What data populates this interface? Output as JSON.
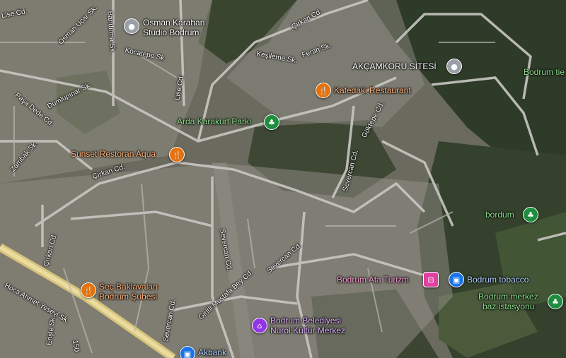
{
  "colors": {
    "restaurant": "#e8710a",
    "park": "#1e8e3e",
    "place": "#9aa0a6",
    "travel": "#e040a0",
    "shop": "#1a73e8",
    "civic": "#9334e6"
  },
  "pois": {
    "osman_karahan": "Osman Karahan Studio Bodrum",
    "osman_karahan_l1": "Osman Karahan",
    "osman_karahan_l2": "Studio Bodrum",
    "kafedaki": "Kafedaki Restaurant",
    "akcamkoru": "AKÇAMKORU SİTESİ",
    "arda_park": "Arda Karakurt Parkı",
    "sunset": "Sunset Restoran Aqua",
    "bordum": "bordum",
    "bodrum_ata": "Bodrum Ata Turizm",
    "tobacco": "Bodrum tobacco",
    "merkez_l1": "Bodrum merkez",
    "merkez_l2": "baz istasyonu",
    "sec_l1": "Seç Baklavaları",
    "sec_l2": "Bodrum Şubesi",
    "belediye_l1": "Bodrum Belediyesi",
    "belediye_l2": "Nurol Kültür Merkez",
    "akbank": "Akbank",
    "bodrum_tie": "Bodrum tie"
  },
  "streets": {
    "lise_top": "Lise Cd.",
    "osman_ucar": "Osman Uçar Sk.",
    "bandirma": "Bandırma Sk.",
    "kocatepe": "Kocatepe Sk.",
    "lise": "Lise Cd.",
    "dumlupinar": "Dumlupınar Sk.",
    "pasa_dede": "Paşa Dede Cd.",
    "zambak": "Zambak Sk.",
    "cirkan_mid": "Çırkan Cd.",
    "cirkan_top": "Çırkan Cd.",
    "cirkan_left": "Çırkan Cd.",
    "kesileme": "Keşileme Sk.",
    "ferah": "Ferah Sk.",
    "goktepe": "Göktepe Cd.",
    "severcan1": "Severcan Cd.",
    "severcan2": "Severcan Cd.",
    "severcan3": "Severcan Cd.",
    "severcan4": "Severcan Cd.",
    "giritli": "Giritli Mustafa Bey Cd.",
    "hoca": "Hoca Ahmet Yesevi Sk.",
    "erisle": "Erişle Sk.",
    "num150": "150"
  },
  "icons": {
    "restaurant": "fork-knife-icon",
    "park": "tree-icon",
    "place": "location-dot-icon",
    "travel": "bed-icon",
    "shop": "shopping-bag-icon",
    "civic": "building-icon"
  }
}
